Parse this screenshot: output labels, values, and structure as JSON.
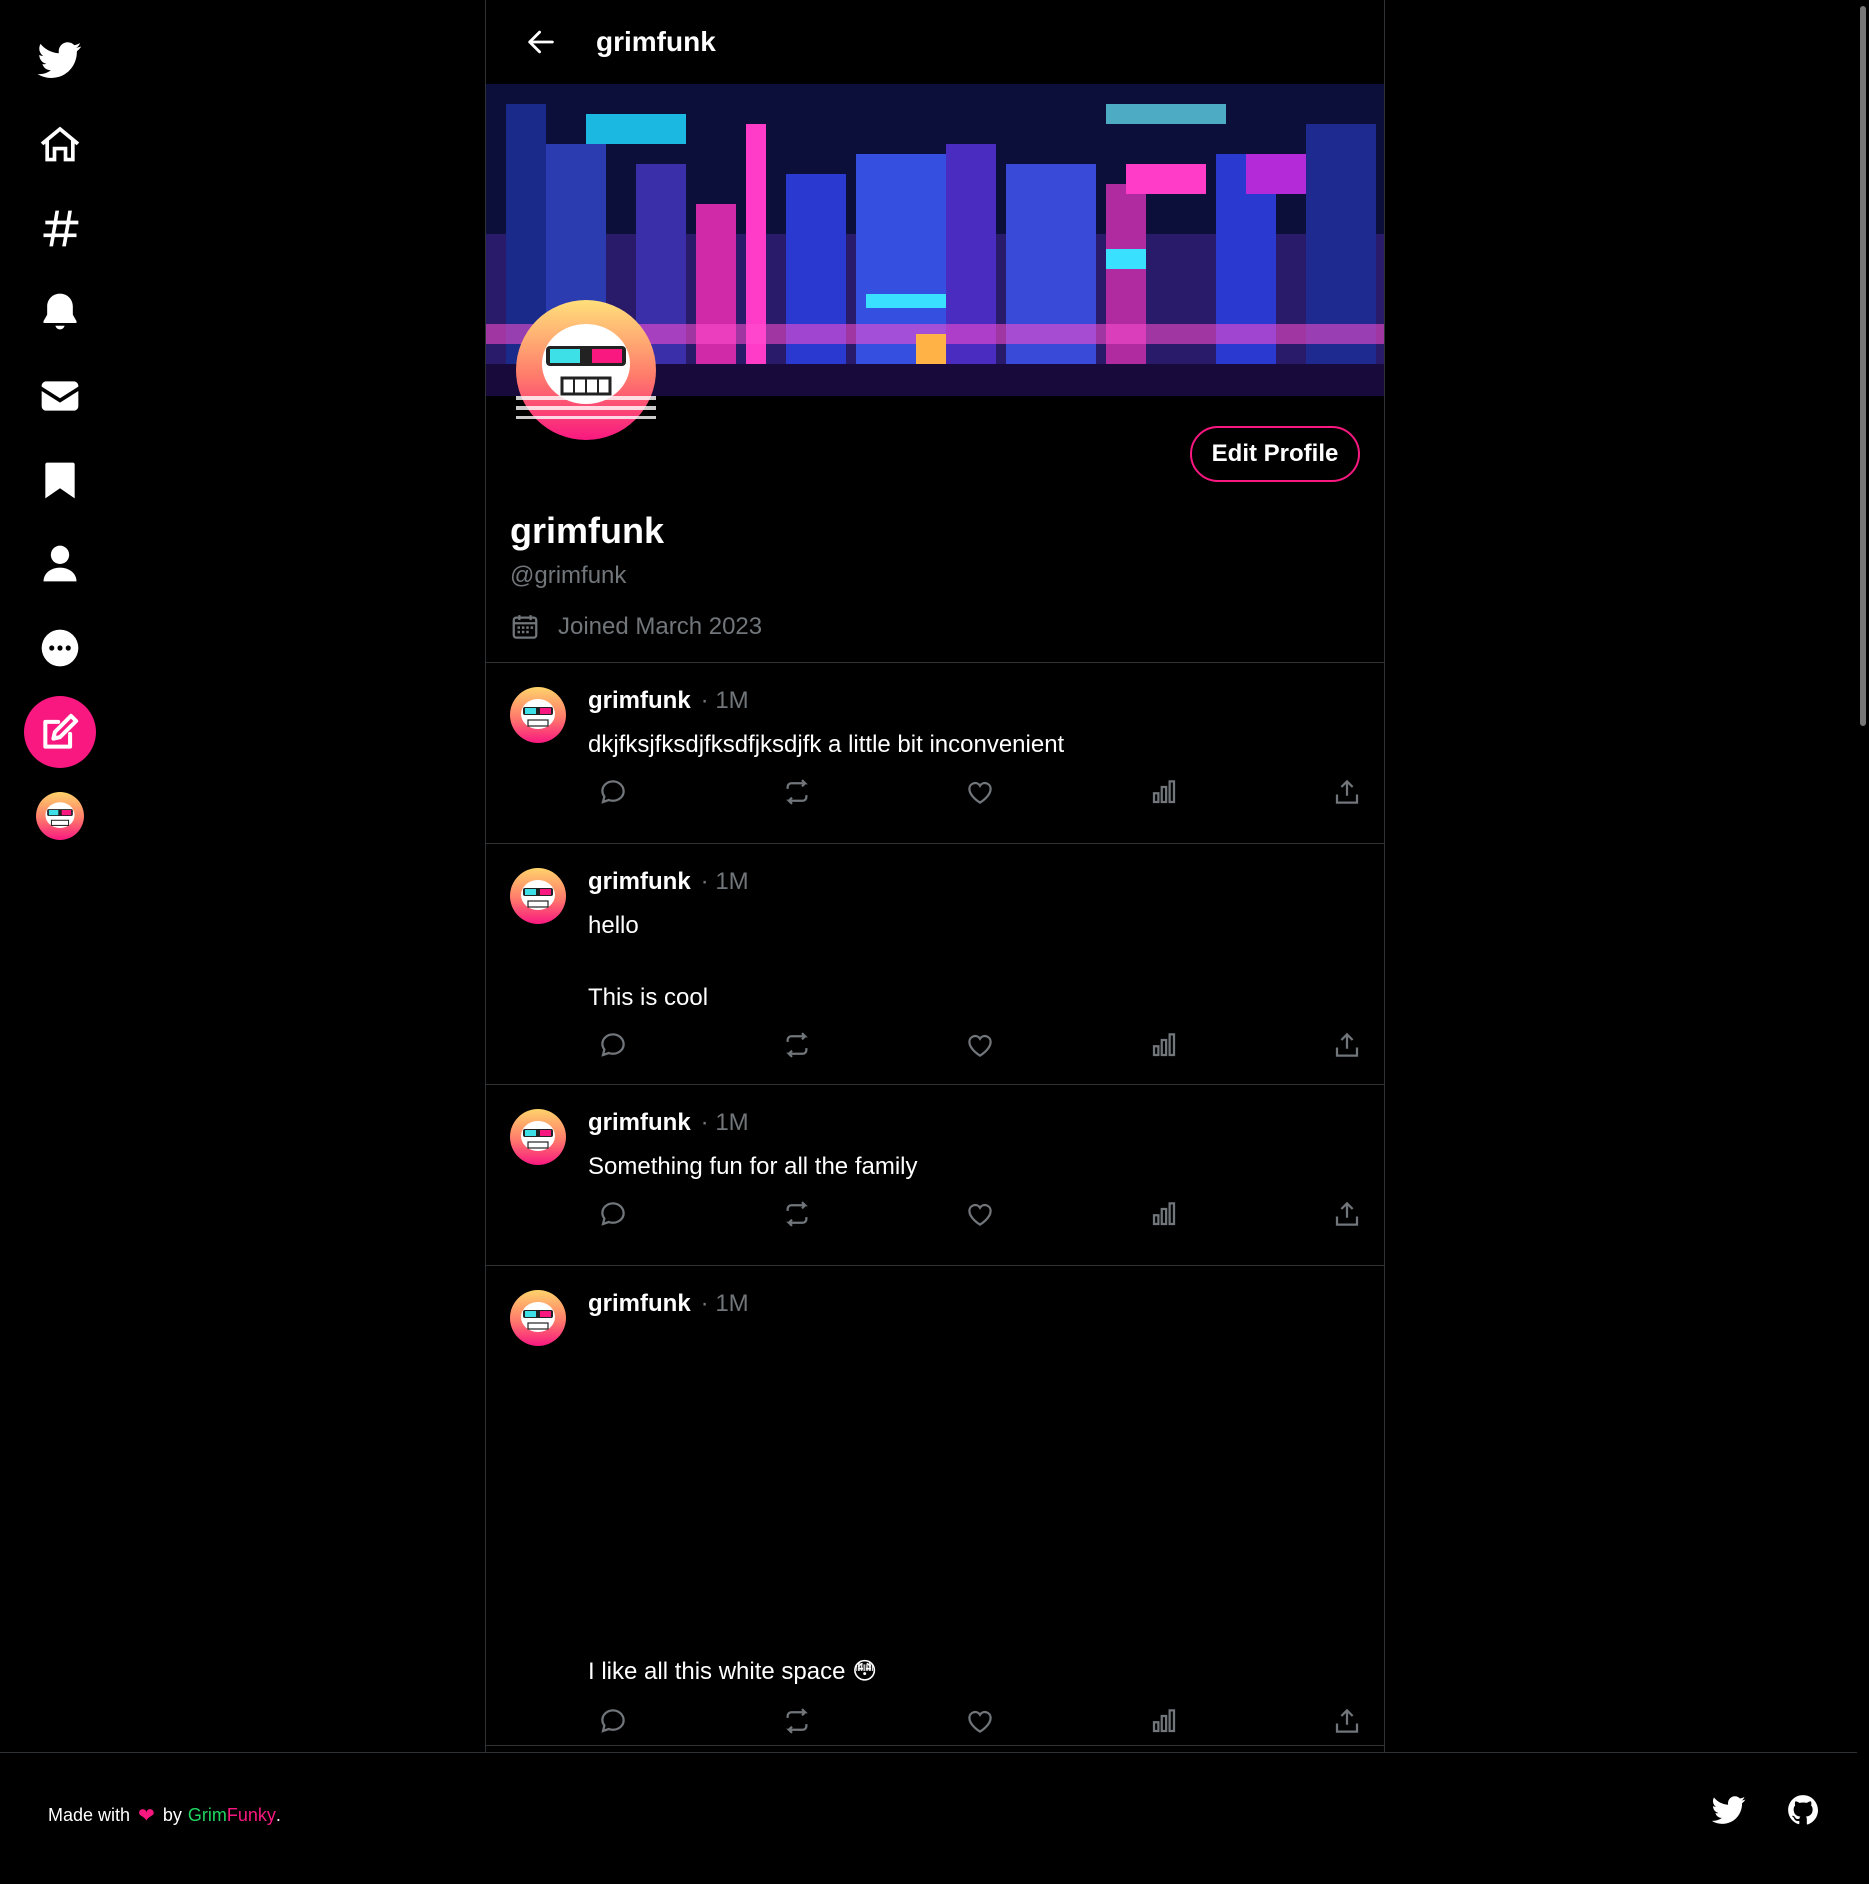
{
  "header": {
    "title": "grimfunk"
  },
  "profile": {
    "display_name": "grimfunk",
    "handle": "@grimfunk",
    "joined": "Joined March 2023",
    "edit_label": "Edit Profile"
  },
  "tweets": [
    {
      "name": "grimfunk",
      "time": "· 1M",
      "text": "dkjfksjfksdjfksdfjksdjfk a little bit inconvenient"
    },
    {
      "name": "grimfunk",
      "time": "· 1M",
      "text": "hello\n\nThis is cool"
    },
    {
      "name": "grimfunk",
      "time": "· 1M",
      "text": "Something fun for all the family"
    },
    {
      "name": "grimfunk",
      "time": "· 1M",
      "text": "I like all this white space 😳"
    }
  ],
  "footer": {
    "made_with": "Made with",
    "heart": "❤",
    "by": "by",
    "grim": "Grim",
    "funky": "Funky",
    "period": "."
  },
  "colors": {
    "accent": "#f91880",
    "green": "#1ed760",
    "muted": "#71767b",
    "border": "#2f3336"
  },
  "icons": {
    "sidebar": [
      "twitter-icon",
      "home-icon",
      "hashtag-icon",
      "bell-icon",
      "envelope-icon",
      "bookmark-icon",
      "user-icon",
      "more-icon",
      "compose-icon"
    ],
    "actions": [
      "reply-icon",
      "retweet-icon",
      "heart-icon",
      "stats-icon",
      "share-icon"
    ],
    "footer": [
      "twitter-icon",
      "github-icon"
    ]
  }
}
